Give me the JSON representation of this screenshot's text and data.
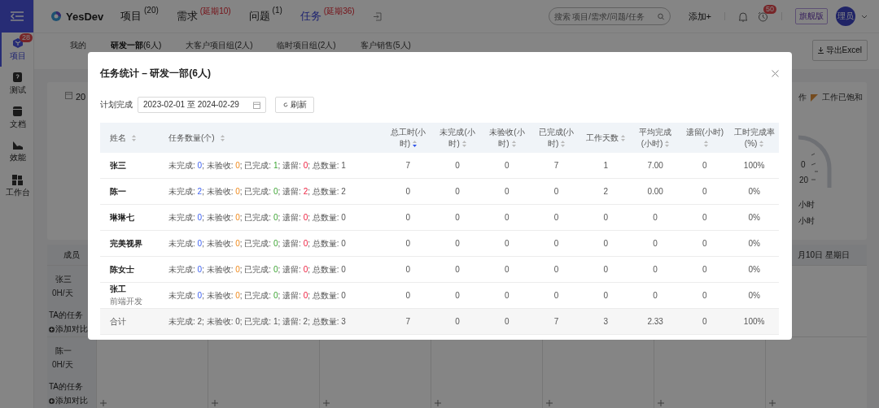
{
  "sidebar": {
    "items": [
      {
        "label": "项目",
        "badge": "28",
        "selected": true
      },
      {
        "label": "测试",
        "selected": false
      },
      {
        "label": "文档",
        "selected": false
      },
      {
        "label": "效能",
        "selected": false
      },
      {
        "label": "工作台",
        "selected": false
      }
    ]
  },
  "topbar": {
    "logo": "YesDev",
    "nav": [
      {
        "label": "项目",
        "count": "(20)",
        "overdue": false,
        "selected": false
      },
      {
        "label": "需求",
        "count": "(延期10)",
        "overdue": true,
        "selected": false
      },
      {
        "label": "问题",
        "count": "(1)",
        "overdue": false,
        "selected": false
      },
      {
        "label": "任务",
        "count": "(延期36)",
        "overdue": true,
        "selected": true
      }
    ],
    "search": {
      "placeholder": "搜索 项目/需求/问题/任务"
    },
    "add": "添加+",
    "alarm_badge": "50",
    "plan": "旗舰版",
    "avatar": "理员"
  },
  "team_tabs": [
    {
      "label": "我的",
      "selected": false
    },
    {
      "label": "研发一部",
      "count": "(6人)",
      "selected": true
    },
    {
      "label": "大客户项目组",
      "count": "(2人)",
      "selected": false
    },
    {
      "label": "临时项目组",
      "count": "(2人)",
      "selected": false
    },
    {
      "label": "客户销售",
      "count": "(5人)",
      "selected": false
    }
  ],
  "export_button": "导出Excel",
  "overview": {
    "date_fragment": "20",
    "legend": [
      {
        "label": "作"
      },
      {
        "label": "工作已饱和",
        "swatch": true
      }
    ],
    "gauge_labels": [
      "0",
      "20"
    ],
    "hour_lines": [
      "小时",
      "小时"
    ]
  },
  "schedule": {
    "member_header": "成员",
    "day_header": "月10日 星期日",
    "members": [
      {
        "name": "张三",
        "load": "0H/天",
        "tasks": "TA的任务",
        "compare": "添加对比"
      },
      {
        "name": "陈一",
        "load": "0H/天",
        "tasks": "TA的任务",
        "compare": "添加对比"
      }
    ]
  },
  "modal": {
    "title": "任务统计 – 研发一部(6人)",
    "filter_label": "计划完成",
    "date_range": "2023-02-01 至 2024-02-29",
    "refresh": "刷新",
    "table": {
      "columns": [
        {
          "label": "姓名",
          "sorted": false
        },
        {
          "label": "任务数量(个)",
          "sorted": false
        },
        {
          "label": "总工时(小时)",
          "sorted": true
        },
        {
          "label": "未完成(小时)",
          "sorted": false
        },
        {
          "label": "未验收(小时)",
          "sorted": false
        },
        {
          "label": "已完成(小时)",
          "sorted": false
        },
        {
          "label": "工作天数",
          "sorted": false
        },
        {
          "label": "平均完成(小时)",
          "sorted": false
        },
        {
          "label": "遗留(小时)",
          "sorted": false
        },
        {
          "label": "工时完成率(%)",
          "sorted": false
        }
      ],
      "rows": [
        {
          "kind": "member",
          "cells": [
            "张三",
            [
              {
                "text": "未完成: "
              },
              {
                "text": "0",
                "kind": "unfinished"
              },
              {
                "text": "; 未验收: "
              },
              {
                "text": "0",
                "kind": "unaccepted"
              },
              {
                "text": "; 已完成: "
              },
              {
                "text": "1",
                "kind": "done"
              },
              {
                "text": "; 遗留: "
              },
              {
                "text": "0",
                "kind": "left"
              },
              {
                "text": "; 总数量: 1"
              }
            ],
            "7",
            "0",
            "0",
            "7",
            "1",
            "7.00",
            "0",
            "100%"
          ]
        },
        {
          "kind": "member",
          "cells": [
            "陈一",
            [
              {
                "text": "未完成: "
              },
              {
                "text": "2",
                "kind": "unfinished"
              },
              {
                "text": "; 未验收: "
              },
              {
                "text": "0",
                "kind": "unaccepted"
              },
              {
                "text": "; 已完成: "
              },
              {
                "text": "0",
                "kind": "done"
              },
              {
                "text": "; 遗留: "
              },
              {
                "text": "2",
                "kind": "left"
              },
              {
                "text": "; 总数量: 2"
              }
            ],
            "0",
            "0",
            "0",
            "0",
            "2",
            "0.00",
            "0",
            "0%"
          ]
        },
        {
          "kind": "member",
          "cells": [
            "琳琳七",
            [
              {
                "text": "未完成: "
              },
              {
                "text": "0",
                "kind": "unfinished"
              },
              {
                "text": "; 未验收: "
              },
              {
                "text": "0",
                "kind": "unaccepted"
              },
              {
                "text": "; 已完成: "
              },
              {
                "text": "0",
                "kind": "done"
              },
              {
                "text": "; 遗留: "
              },
              {
                "text": "0",
                "kind": "left"
              },
              {
                "text": "; 总数量: 0"
              }
            ],
            "0",
            "0",
            "0",
            "0",
            "0",
            "0",
            "0",
            "0%"
          ]
        },
        {
          "kind": "member",
          "cells": [
            "完美视界",
            [
              {
                "text": "未完成: "
              },
              {
                "text": "0",
                "kind": "unfinished"
              },
              {
                "text": "; 未验收: "
              },
              {
                "text": "0",
                "kind": "unaccepted"
              },
              {
                "text": "; 已完成: "
              },
              {
                "text": "0",
                "kind": "done"
              },
              {
                "text": "; 遗留: "
              },
              {
                "text": "0",
                "kind": "left"
              },
              {
                "text": "; 总数量: 0"
              }
            ],
            "0",
            "0",
            "0",
            "0",
            "0",
            "0",
            "0",
            "0%"
          ]
        },
        {
          "kind": "member",
          "cells": [
            "陈女士",
            [
              {
                "text": "未完成: "
              },
              {
                "text": "0",
                "kind": "unfinished"
              },
              {
                "text": "; 未验收: "
              },
              {
                "text": "0",
                "kind": "unaccepted"
              },
              {
                "text": "; 已完成: "
              },
              {
                "text": "0",
                "kind": "done"
              },
              {
                "text": "; 遗留: "
              },
              {
                "text": "0",
                "kind": "left"
              },
              {
                "text": "; 总数量: 0"
              }
            ],
            "0",
            "0",
            "0",
            "0",
            "0",
            "0",
            "0",
            "0%"
          ]
        },
        {
          "kind": "member",
          "role": "前端开发",
          "cells": [
            "张工",
            [
              {
                "text": "未完成: "
              },
              {
                "text": "0",
                "kind": "unfinished"
              },
              {
                "text": "; 未验收: "
              },
              {
                "text": "0",
                "kind": "unaccepted"
              },
              {
                "text": "; 已完成: "
              },
              {
                "text": "0",
                "kind": "done"
              },
              {
                "text": "; 遗留: "
              },
              {
                "text": "0",
                "kind": "left"
              },
              {
                "text": "; 总数量: 0"
              }
            ],
            "0",
            "0",
            "0",
            "0",
            "0",
            "0",
            "0",
            "0%"
          ]
        },
        {
          "kind": "total",
          "cells": [
            "合计",
            [
              {
                "text": "未完成: 2; 未验收: 0; 已完成: 1; 遗留: 2; 总数量: 3"
              }
            ],
            "7",
            "0",
            "0",
            "7",
            "3",
            "2.33",
            "0",
            "100%"
          ]
        }
      ]
    }
  }
}
